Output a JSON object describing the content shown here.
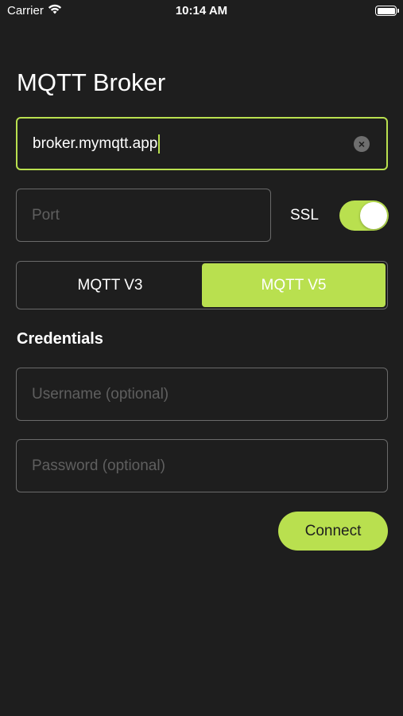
{
  "status_bar": {
    "carrier": "Carrier",
    "time": "10:14 AM",
    "wifi_icon": "wifi-icon",
    "battery_icon": "battery-icon"
  },
  "title": "MQTT Broker",
  "broker": {
    "value": "broker.mymqtt.app",
    "clear_icon": "clear-circle-icon"
  },
  "port": {
    "value": "",
    "placeholder": "Port"
  },
  "ssl": {
    "label": "SSL",
    "enabled": true
  },
  "protocol": {
    "options": [
      "MQTT V3",
      "MQTT V5"
    ],
    "selected": "MQTT V5"
  },
  "credentials": {
    "heading": "Credentials",
    "username_placeholder": "Username (optional)",
    "password_placeholder": "Password (optional)"
  },
  "connect_label": "Connect",
  "colors": {
    "accent": "#b9e04f",
    "background": "#1e1e1e",
    "border": "#6a6a6a",
    "placeholder": "#5f5f5f"
  }
}
